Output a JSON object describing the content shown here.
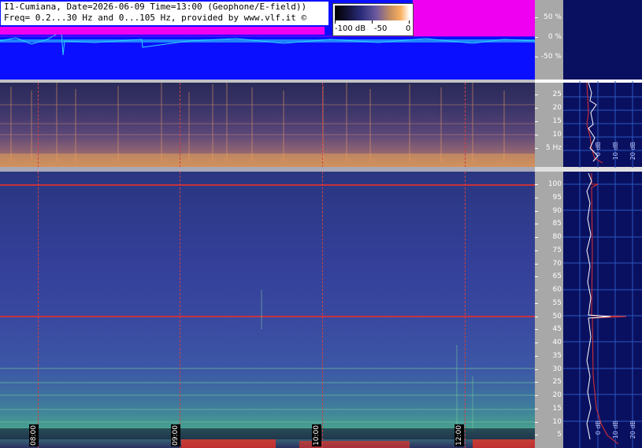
{
  "header": {
    "line1": "I1-Cumiana, Date=2026-06-09 Time=13:00 (Geophone/E-field))",
    "line2": "Freq= 0.2...30 Hz and 0...105 Hz, provided by www.vlf.it ©"
  },
  "colorbar": {
    "labels": [
      "-100 dB",
      "-50",
      "0"
    ]
  },
  "waveform_axis": [
    "50 %",
    "0 %",
    "-50 %"
  ],
  "lowfreq_axis": [
    "25",
    "20",
    "15",
    "10",
    "5 Hz"
  ],
  "highfreq_axis": [
    "100",
    "95",
    "90",
    "85",
    "80",
    "75",
    "70",
    "65",
    "60",
    "55",
    "50",
    "45",
    "40",
    "35",
    "30",
    "25",
    "20",
    "15",
    "10",
    "5"
  ],
  "time_labels": [
    "08:00",
    "09:00",
    "10:00",
    "12:00"
  ],
  "profile_labels_top": [
    "0 dB",
    "10 dB",
    "20 dB"
  ],
  "profile_labels_bottom": [
    "0 dB",
    "10 dB",
    "20 dB"
  ],
  "colors": {
    "wave_bg": "#0a10ff",
    "burst": "#f000f0",
    "trace": "#30d0ff",
    "marker_line": "#d04040",
    "profile_bg": "#0a1060"
  }
}
